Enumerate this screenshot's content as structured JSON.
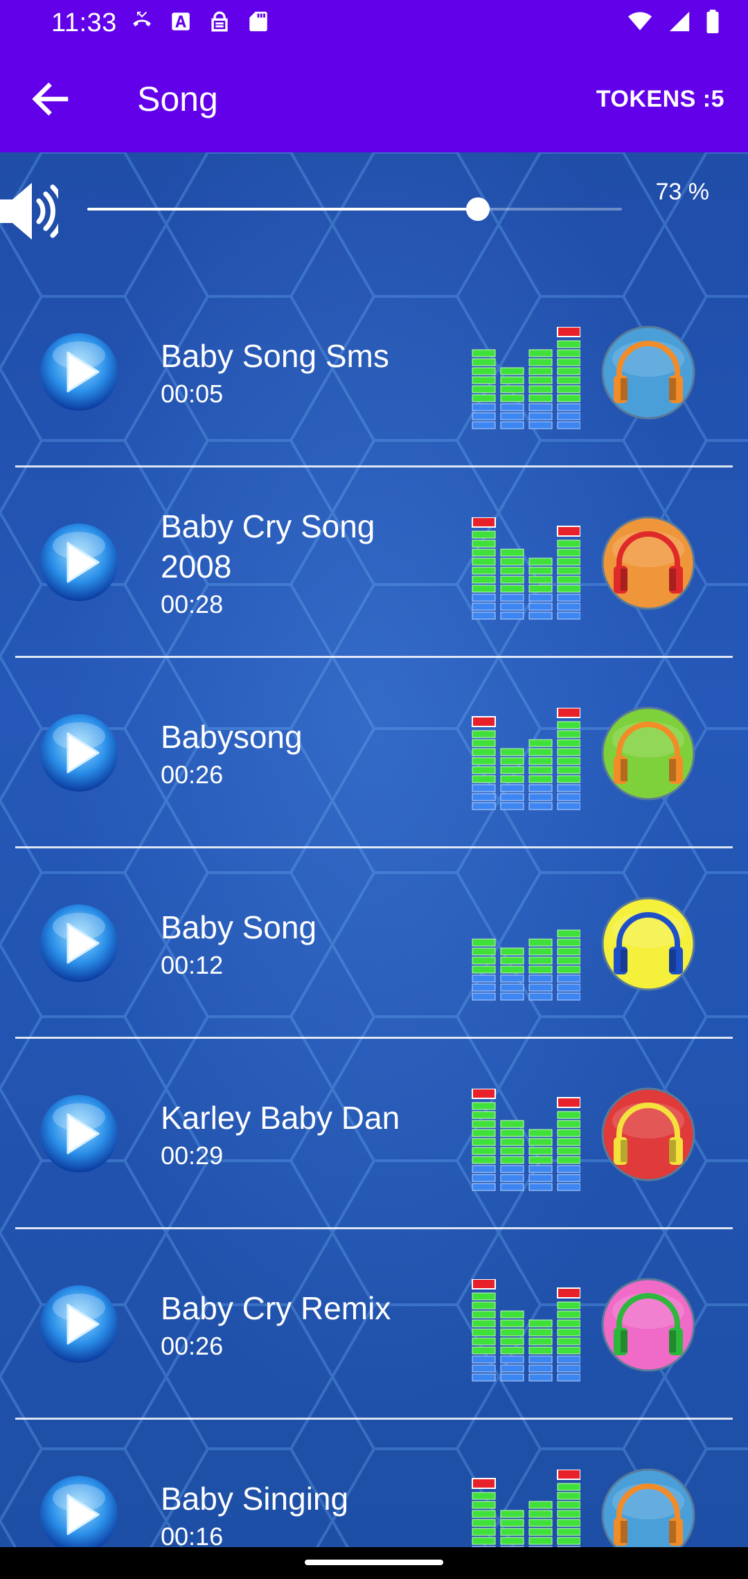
{
  "status_bar": {
    "time": "11:33",
    "left_icons": [
      "missed-call-icon",
      "text-a-icon",
      "lock-icon",
      "sd-card-icon"
    ],
    "right_icons": [
      "wifi-icon",
      "signal-icon",
      "battery-icon"
    ]
  },
  "app_bar": {
    "back_icon": "arrow-left-icon",
    "title": "Song",
    "tokens": "TOKENS :5",
    "background": "#6200ea"
  },
  "volume": {
    "icon": "speaker-icon",
    "percent_label": "73 %",
    "level": 0.73
  },
  "songs": [
    {
      "name": "Baby Song Sms",
      "duration": "00:05",
      "headphone_color": "#4a9fd9",
      "headphone_band": "#f28c28",
      "eq_levels": [
        6,
        4,
        6,
        7
      ],
      "eq_peaks": [
        false,
        false,
        false,
        true
      ]
    },
    {
      "name": "Baby Cry Song 2008",
      "duration": "00:28",
      "headphone_color": "#f0963a",
      "headphone_band": "#e02a2a",
      "eq_levels": [
        7,
        5,
        4,
        6
      ],
      "eq_peaks": [
        true,
        false,
        false,
        true
      ]
    },
    {
      "name": "Babysong",
      "duration": "00:26",
      "headphone_color": "#7fd13b",
      "headphone_band": "#f28c28",
      "eq_levels": [
        6,
        4,
        5,
        7
      ],
      "eq_peaks": [
        true,
        false,
        false,
        true
      ]
    },
    {
      "name": "Baby Song",
      "duration": "00:12",
      "headphone_color": "#f5f03c",
      "headphone_band": "#1e4fc7",
      "eq_levels": [
        4,
        3,
        4,
        5
      ],
      "eq_peaks": [
        false,
        false,
        false,
        false
      ]
    },
    {
      "name": "Karley Baby Dan",
      "duration": "00:29",
      "headphone_color": "#e03a3a",
      "headphone_band": "#f5e13c",
      "eq_levels": [
        7,
        5,
        4,
        6
      ],
      "eq_peaks": [
        true,
        false,
        false,
        true
      ]
    },
    {
      "name": "Baby Cry Remix",
      "duration": "00:26",
      "headphone_color": "#f06ac8",
      "headphone_band": "#2db83d",
      "eq_levels": [
        7,
        5,
        4,
        6
      ],
      "eq_peaks": [
        true,
        false,
        false,
        true
      ]
    },
    {
      "name": "Baby Singing",
      "duration": "00:16",
      "headphone_color": "#4a9fd9",
      "headphone_band": "#f28c28",
      "eq_levels": [
        6,
        4,
        5,
        7
      ],
      "eq_peaks": [
        true,
        false,
        false,
        true
      ]
    }
  ]
}
